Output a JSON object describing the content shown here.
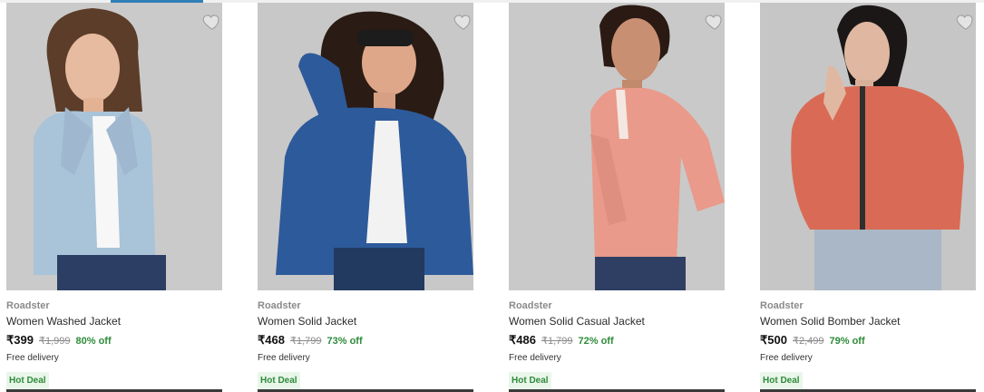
{
  "products": [
    {
      "brand": "Roadster",
      "name": "Women Washed Jacket",
      "price": "₹399",
      "mrp": "₹1,999",
      "discount": "80% off",
      "delivery": "Free delivery",
      "badge": "Hot Deal",
      "colors": {
        "bg": "#c9c9c9",
        "jacket": "#a9c3d9",
        "shirt": "#f7f7f7",
        "skin": "#e5b79a",
        "hair": "#5c3d29"
      }
    },
    {
      "brand": "Roadster",
      "name": "Women Solid Jacket",
      "price": "₹468",
      "mrp": "₹1,799",
      "discount": "73% off",
      "delivery": "Free delivery",
      "badge": "Hot Deal",
      "colors": {
        "bg": "#c7c7c7",
        "jacket": "#2d5a9a",
        "shirt": "#f2f2f2",
        "skin": "#dfa789",
        "hair": "#2a1b14"
      }
    },
    {
      "brand": "Roadster",
      "name": "Women Solid Casual Jacket",
      "price": "₹486",
      "mrp": "₹1,799",
      "discount": "72% off",
      "delivery": "Free delivery",
      "badge": "Hot Deal",
      "colors": {
        "bg": "#c8c8c8",
        "jacket": "#e99a8a",
        "shirt": "#f4e7e1",
        "skin": "#c98f72",
        "hair": "#2a1a13"
      }
    },
    {
      "brand": "Roadster",
      "name": "Women Solid Bomber Jacket",
      "price": "₹500",
      "mrp": "₹2,499",
      "discount": "79% off",
      "delivery": "Free delivery",
      "badge": "Hot Deal",
      "colors": {
        "bg": "#c6c6c6",
        "jacket": "#d96b56",
        "shirt": "#a9b7c6",
        "skin": "#e0b8a2",
        "hair": "#1c1717"
      }
    }
  ],
  "icons": {
    "wishlist": "heart-icon"
  }
}
